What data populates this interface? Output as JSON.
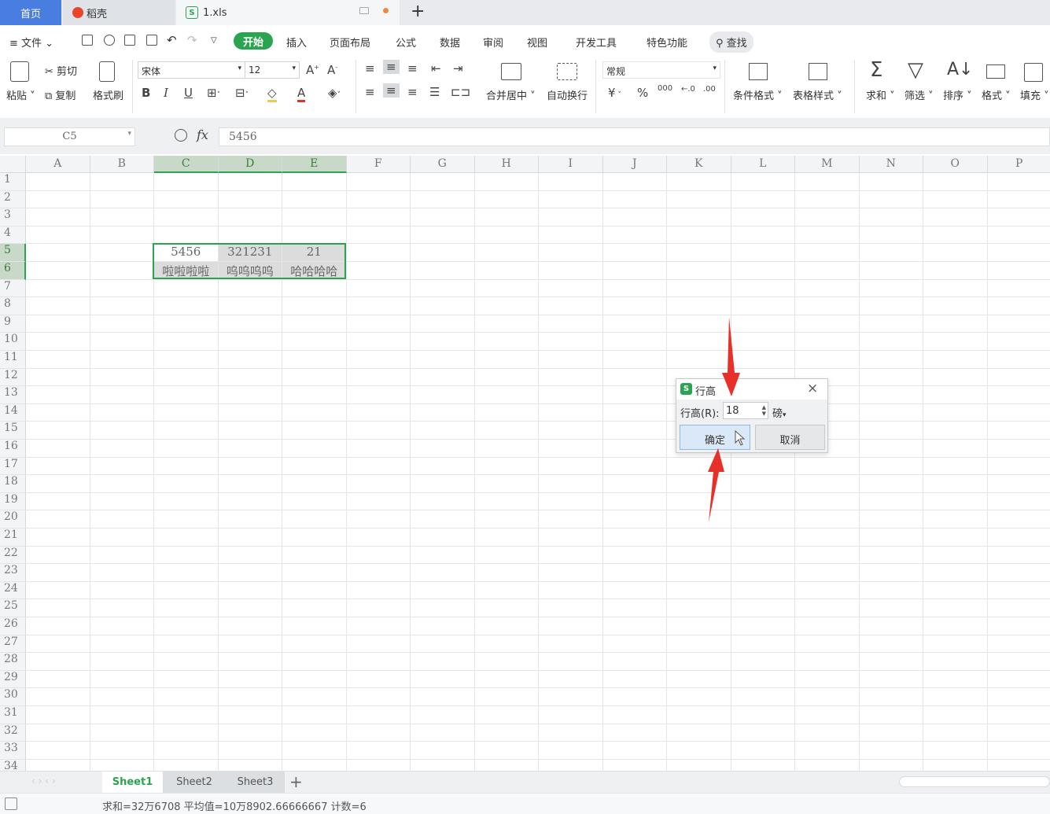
{
  "titlebar": {
    "home_tab": "首页",
    "daoke_tab": "稻壳",
    "file_tab": "1.xls",
    "file_logo": "S",
    "new_tab_icon": "+"
  },
  "menu": {
    "file": "文件",
    "items": [
      "开始",
      "插入",
      "页面布局",
      "公式",
      "数据",
      "审阅",
      "视图",
      "开发工具",
      "特色功能"
    ],
    "search": "查找"
  },
  "ribbon": {
    "paste": "粘贴",
    "cut": "剪切",
    "copy": "复制",
    "format_painter": "格式刷",
    "font_name": "宋体",
    "font_size": "12",
    "bold": "B",
    "italic": "I",
    "underline": "U",
    "font_color": "A",
    "merge_center": "合并居中",
    "wrap_text": "自动换行",
    "number_format": "常规",
    "currency": "¥",
    "percent": "%",
    "thousands": "000",
    "conditional_format": "条件格式",
    "table_style": "表格样式",
    "sum": "求和",
    "filter": "筛选",
    "sort": "排序",
    "format": "格式",
    "fill": "填充"
  },
  "formula_bar": {
    "cell_ref": "C5",
    "fx": "fx",
    "value": "5456"
  },
  "grid": {
    "columns": [
      "A",
      "B",
      "C",
      "D",
      "E",
      "F",
      "G",
      "H",
      "I",
      "J",
      "K",
      "L",
      "M",
      "N",
      "O",
      "P"
    ],
    "selected_columns": [
      "C",
      "D",
      "E"
    ],
    "rows": [
      "1",
      "2",
      "3",
      "4",
      "5",
      "6",
      "7",
      "8",
      "9",
      "10",
      "11",
      "12",
      "13",
      "14",
      "15",
      "16",
      "17",
      "18",
      "19",
      "20",
      "21",
      "22",
      "23",
      "24",
      "25",
      "26",
      "27",
      "28",
      "29",
      "30",
      "31",
      "32",
      "33",
      "34"
    ],
    "selected_rows": [
      "5",
      "6"
    ],
    "cells": {
      "C5": "5456",
      "D5": "321231",
      "E5": "21",
      "C6": "啦啦啦啦",
      "D6": "呜呜呜呜",
      "E6": "哈哈哈哈"
    }
  },
  "sheets": [
    "Sheet1",
    "Sheet2",
    "Sheet3"
  ],
  "active_sheet": "Sheet1",
  "status": {
    "text": "求和=32万6708  平均值=10万8902.66666667  计数=6"
  },
  "dialog": {
    "logo": "S",
    "title": "行高",
    "label": "行高(R):",
    "value": "18",
    "unit": "磅",
    "ok": "确定",
    "cancel": "取消",
    "close_icon": "×"
  },
  "colors": {
    "accent": "#2aa44f",
    "home_tab": "#4a7de0",
    "annotation_arrow": "#e8302a"
  }
}
